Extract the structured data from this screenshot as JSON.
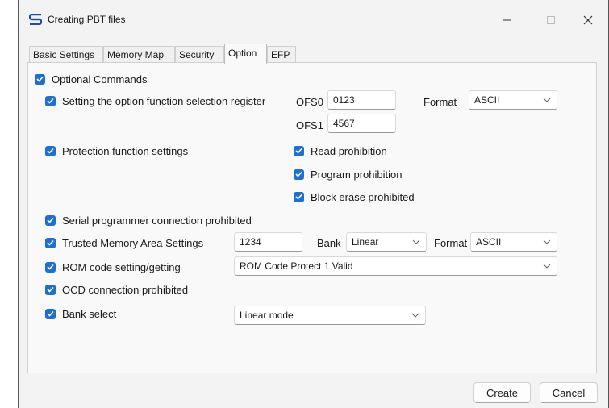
{
  "window": {
    "title": "Creating PBT files"
  },
  "tabs": [
    "Basic Settings",
    "Memory Map",
    "Security",
    "Option",
    "EFP"
  ],
  "active_tab": "Option",
  "colors": {
    "checkbox": "#1e6fd0",
    "window_bg": "#f3f3f3",
    "panel_bg": "#f9f9f9"
  },
  "option": {
    "optional_commands": "Optional Commands",
    "ofs": {
      "label": "Setting the option function selection register",
      "ofs0_label": "OFS0",
      "ofs0_value": "0123",
      "ofs1_label": "OFS1",
      "ofs1_value": "4567",
      "format_label": "Format",
      "format_value": "ASCII"
    },
    "protection": {
      "label": "Protection function settings",
      "read": "Read prohibition",
      "program": "Program prohibition",
      "block_erase": "Block erase prohibited"
    },
    "serial": "Serial programmer connection prohibited",
    "trusted": {
      "label": "Trusted Memory Area Settings",
      "value": "1234",
      "bank_label": "Bank",
      "bank_value": "Linear",
      "format_label": "Format",
      "format_value": "ASCII"
    },
    "rom": {
      "label": "ROM code setting/getting",
      "value": "ROM Code Protect 1 Valid"
    },
    "ocd": "OCD connection prohibited",
    "bank_select": {
      "label": "Bank select",
      "value": "Linear mode"
    }
  },
  "buttons": {
    "create": "Create",
    "cancel": "Cancel"
  }
}
